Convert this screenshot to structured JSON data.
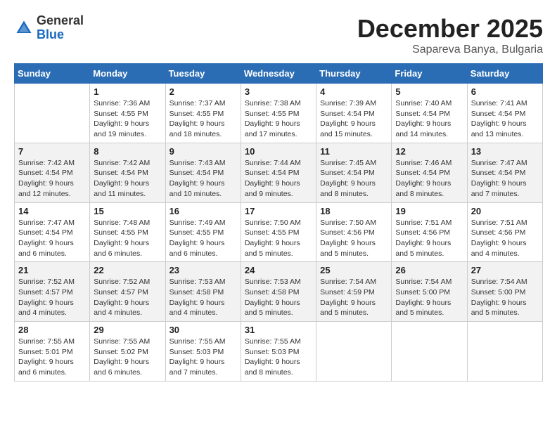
{
  "header": {
    "logo_general": "General",
    "logo_blue": "Blue",
    "month_title": "December 2025",
    "location": "Sapareva Banya, Bulgaria"
  },
  "days_of_week": [
    "Sunday",
    "Monday",
    "Tuesday",
    "Wednesday",
    "Thursday",
    "Friday",
    "Saturday"
  ],
  "weeks": [
    [
      {
        "day": "",
        "sunrise": "",
        "sunset": "",
        "daylight": ""
      },
      {
        "day": "1",
        "sunrise": "Sunrise: 7:36 AM",
        "sunset": "Sunset: 4:55 PM",
        "daylight": "Daylight: 9 hours and 19 minutes."
      },
      {
        "day": "2",
        "sunrise": "Sunrise: 7:37 AM",
        "sunset": "Sunset: 4:55 PM",
        "daylight": "Daylight: 9 hours and 18 minutes."
      },
      {
        "day": "3",
        "sunrise": "Sunrise: 7:38 AM",
        "sunset": "Sunset: 4:55 PM",
        "daylight": "Daylight: 9 hours and 17 minutes."
      },
      {
        "day": "4",
        "sunrise": "Sunrise: 7:39 AM",
        "sunset": "Sunset: 4:54 PM",
        "daylight": "Daylight: 9 hours and 15 minutes."
      },
      {
        "day": "5",
        "sunrise": "Sunrise: 7:40 AM",
        "sunset": "Sunset: 4:54 PM",
        "daylight": "Daylight: 9 hours and 14 minutes."
      },
      {
        "day": "6",
        "sunrise": "Sunrise: 7:41 AM",
        "sunset": "Sunset: 4:54 PM",
        "daylight": "Daylight: 9 hours and 13 minutes."
      }
    ],
    [
      {
        "day": "7",
        "sunrise": "Sunrise: 7:42 AM",
        "sunset": "Sunset: 4:54 PM",
        "daylight": "Daylight: 9 hours and 12 minutes."
      },
      {
        "day": "8",
        "sunrise": "Sunrise: 7:42 AM",
        "sunset": "Sunset: 4:54 PM",
        "daylight": "Daylight: 9 hours and 11 minutes."
      },
      {
        "day": "9",
        "sunrise": "Sunrise: 7:43 AM",
        "sunset": "Sunset: 4:54 PM",
        "daylight": "Daylight: 9 hours and 10 minutes."
      },
      {
        "day": "10",
        "sunrise": "Sunrise: 7:44 AM",
        "sunset": "Sunset: 4:54 PM",
        "daylight": "Daylight: 9 hours and 9 minutes."
      },
      {
        "day": "11",
        "sunrise": "Sunrise: 7:45 AM",
        "sunset": "Sunset: 4:54 PM",
        "daylight": "Daylight: 9 hours and 8 minutes."
      },
      {
        "day": "12",
        "sunrise": "Sunrise: 7:46 AM",
        "sunset": "Sunset: 4:54 PM",
        "daylight": "Daylight: 9 hours and 8 minutes."
      },
      {
        "day": "13",
        "sunrise": "Sunrise: 7:47 AM",
        "sunset": "Sunset: 4:54 PM",
        "daylight": "Daylight: 9 hours and 7 minutes."
      }
    ],
    [
      {
        "day": "14",
        "sunrise": "Sunrise: 7:47 AM",
        "sunset": "Sunset: 4:54 PM",
        "daylight": "Daylight: 9 hours and 6 minutes."
      },
      {
        "day": "15",
        "sunrise": "Sunrise: 7:48 AM",
        "sunset": "Sunset: 4:55 PM",
        "daylight": "Daylight: 9 hours and 6 minutes."
      },
      {
        "day": "16",
        "sunrise": "Sunrise: 7:49 AM",
        "sunset": "Sunset: 4:55 PM",
        "daylight": "Daylight: 9 hours and 6 minutes."
      },
      {
        "day": "17",
        "sunrise": "Sunrise: 7:50 AM",
        "sunset": "Sunset: 4:55 PM",
        "daylight": "Daylight: 9 hours and 5 minutes."
      },
      {
        "day": "18",
        "sunrise": "Sunrise: 7:50 AM",
        "sunset": "Sunset: 4:56 PM",
        "daylight": "Daylight: 9 hours and 5 minutes."
      },
      {
        "day": "19",
        "sunrise": "Sunrise: 7:51 AM",
        "sunset": "Sunset: 4:56 PM",
        "daylight": "Daylight: 9 hours and 5 minutes."
      },
      {
        "day": "20",
        "sunrise": "Sunrise: 7:51 AM",
        "sunset": "Sunset: 4:56 PM",
        "daylight": "Daylight: 9 hours and 4 minutes."
      }
    ],
    [
      {
        "day": "21",
        "sunrise": "Sunrise: 7:52 AM",
        "sunset": "Sunset: 4:57 PM",
        "daylight": "Daylight: 9 hours and 4 minutes."
      },
      {
        "day": "22",
        "sunrise": "Sunrise: 7:52 AM",
        "sunset": "Sunset: 4:57 PM",
        "daylight": "Daylight: 9 hours and 4 minutes."
      },
      {
        "day": "23",
        "sunrise": "Sunrise: 7:53 AM",
        "sunset": "Sunset: 4:58 PM",
        "daylight": "Daylight: 9 hours and 4 minutes."
      },
      {
        "day": "24",
        "sunrise": "Sunrise: 7:53 AM",
        "sunset": "Sunset: 4:58 PM",
        "daylight": "Daylight: 9 hours and 5 minutes."
      },
      {
        "day": "25",
        "sunrise": "Sunrise: 7:54 AM",
        "sunset": "Sunset: 4:59 PM",
        "daylight": "Daylight: 9 hours and 5 minutes."
      },
      {
        "day": "26",
        "sunrise": "Sunrise: 7:54 AM",
        "sunset": "Sunset: 5:00 PM",
        "daylight": "Daylight: 9 hours and 5 minutes."
      },
      {
        "day": "27",
        "sunrise": "Sunrise: 7:54 AM",
        "sunset": "Sunset: 5:00 PM",
        "daylight": "Daylight: 9 hours and 5 minutes."
      }
    ],
    [
      {
        "day": "28",
        "sunrise": "Sunrise: 7:55 AM",
        "sunset": "Sunset: 5:01 PM",
        "daylight": "Daylight: 9 hours and 6 minutes."
      },
      {
        "day": "29",
        "sunrise": "Sunrise: 7:55 AM",
        "sunset": "Sunset: 5:02 PM",
        "daylight": "Daylight: 9 hours and 6 minutes."
      },
      {
        "day": "30",
        "sunrise": "Sunrise: 7:55 AM",
        "sunset": "Sunset: 5:03 PM",
        "daylight": "Daylight: 9 hours and 7 minutes."
      },
      {
        "day": "31",
        "sunrise": "Sunrise: 7:55 AM",
        "sunset": "Sunset: 5:03 PM",
        "daylight": "Daylight: 9 hours and 8 minutes."
      },
      {
        "day": "",
        "sunrise": "",
        "sunset": "",
        "daylight": ""
      },
      {
        "day": "",
        "sunrise": "",
        "sunset": "",
        "daylight": ""
      },
      {
        "day": "",
        "sunrise": "",
        "sunset": "",
        "daylight": ""
      }
    ]
  ]
}
